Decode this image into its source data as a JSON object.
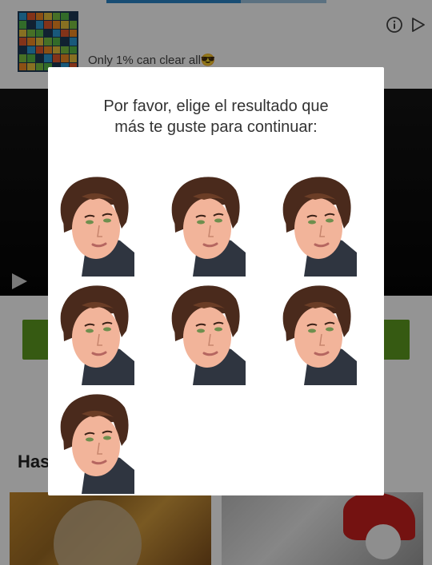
{
  "progress": {
    "fraction": 0.61
  },
  "ad": {
    "text": "Only 1% can clear all😎",
    "info_icon": "info-circle-icon",
    "play_icon": "play-store-icon"
  },
  "video": {
    "play_icon": "play-icon"
  },
  "section": {
    "heading": "Has"
  },
  "dialog": {
    "title_line1": "Por favor, elige el resultado que",
    "title_line2": "más te guste para continuar:",
    "results": [
      {
        "label": "result-1"
      },
      {
        "label": "result-2"
      },
      {
        "label": "result-3"
      },
      {
        "label": "result-4"
      },
      {
        "label": "result-5"
      },
      {
        "label": "result-6"
      },
      {
        "label": "result-7"
      }
    ]
  },
  "colors": {
    "accent_blue": "#2a86c9",
    "button_green": "#5e9b1f",
    "hair": "#4a2a1c",
    "skin": "#f2b49a",
    "shirt": "#2f3540"
  }
}
